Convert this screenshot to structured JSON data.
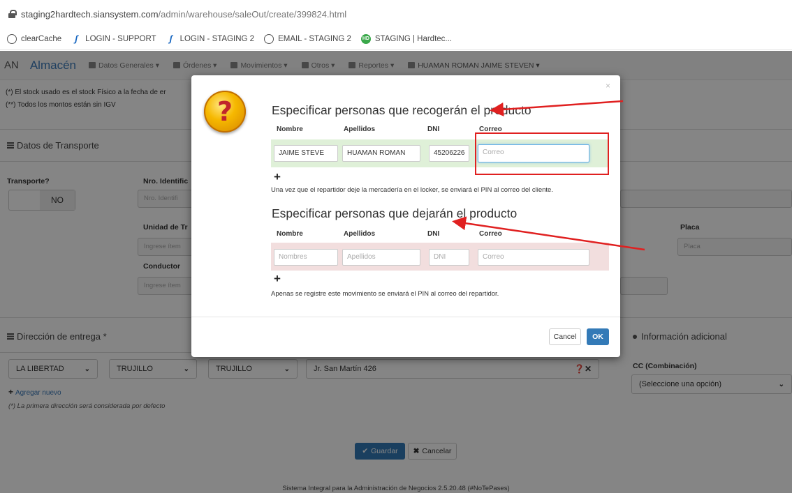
{
  "browser": {
    "url_host": "staging2hardtech.siansystem.com",
    "url_path": "/admin/warehouse/saleOut/create/399824.html",
    "bookmarks": [
      {
        "label": "clearCache",
        "icon": "globe-icon"
      },
      {
        "label": "LOGIN - SUPPORT",
        "icon": "s-logo-icon"
      },
      {
        "label": "LOGIN - STAGING 2",
        "icon": "s-logo-icon"
      },
      {
        "label": "EMAIL - STAGING 2",
        "icon": "globe-icon"
      },
      {
        "label": "STAGING | Hardtec...",
        "icon": "hd-logo-icon"
      }
    ]
  },
  "navbar": {
    "brand_short": "AN",
    "brand": "Almacén",
    "items": [
      "Datos Generales ▾",
      "Órdenes ▾",
      "Movimientos ▾",
      "Otros ▾",
      "Reportes ▾"
    ],
    "user": "HUAMAN ROMAN JAIME STEVEN ▾"
  },
  "page": {
    "note1": "(*) El stock usado es el stock Físico a la fecha de er",
    "note2": "(**) Todos los montos están sin IGV",
    "transport_header": "Datos de Transporte",
    "transporte_label": "Transporte?",
    "transporte_value": "NO",
    "nro_identific_label": "Nro. Identific",
    "nro_identific_placeholder": "Nro. Identifi",
    "unidad_label": "Unidad de Tr",
    "unidad_placeholder": "Ingrese ítem",
    "conductor_label": "Conductor",
    "conductor_placeholder": "Ingrese ítem",
    "placa_label": "Placa",
    "placa_placeholder": "Placa",
    "direccion_header": "Dirección de entrega *",
    "region": "LA LIBERTAD",
    "provincia": "TRUJILLO",
    "distrito": "TRUJILLO",
    "address": "Jr. San Martín 426",
    "add_new": "Agregar nuevo",
    "first_address_note": "(*) La primera dirección será considerada por defecto",
    "info_header": "Información adicional",
    "cc_label": "CC (Combinación)",
    "cc_value": "(Seleccione una opción)",
    "save": "Guardar",
    "cancel": "Cancelar",
    "footer": "Sistema Integral para la Administración de Negocios 2.5.20.48 (#NoTePases)"
  },
  "modal": {
    "title_pickup": "Especificar personas que recogerán el producto",
    "title_dropoff": "Especificar personas que dejarán el producto",
    "columns": [
      "Nombre",
      "Apellidos",
      "DNI",
      "Correo"
    ],
    "pickup_row": {
      "nombre": "JAIME STEVE",
      "apellidos": "HUAMAN ROMAN",
      "dni": "45206226",
      "correo_placeholder": "Correo"
    },
    "dropoff_row": {
      "nombre_placeholder": "Nombres",
      "apellidos_placeholder": "Apellidos",
      "dni_placeholder": "DNI",
      "correo_placeholder": "Correo"
    },
    "pickup_help": "Una vez que el repartidor deje la mercadería en el locker, se enviará el PIN al correo del cliente.",
    "dropoff_help": "Apenas se registre este movimiento se enviará el PIN al correo del repartidor.",
    "cancel": "Cancel",
    "ok": "OK",
    "close": "×",
    "question": "?"
  },
  "colors": {
    "accent": "#337ab7",
    "annotation": "#e02020",
    "success_row": "#dff0d8",
    "danger_row": "#f2dede"
  }
}
